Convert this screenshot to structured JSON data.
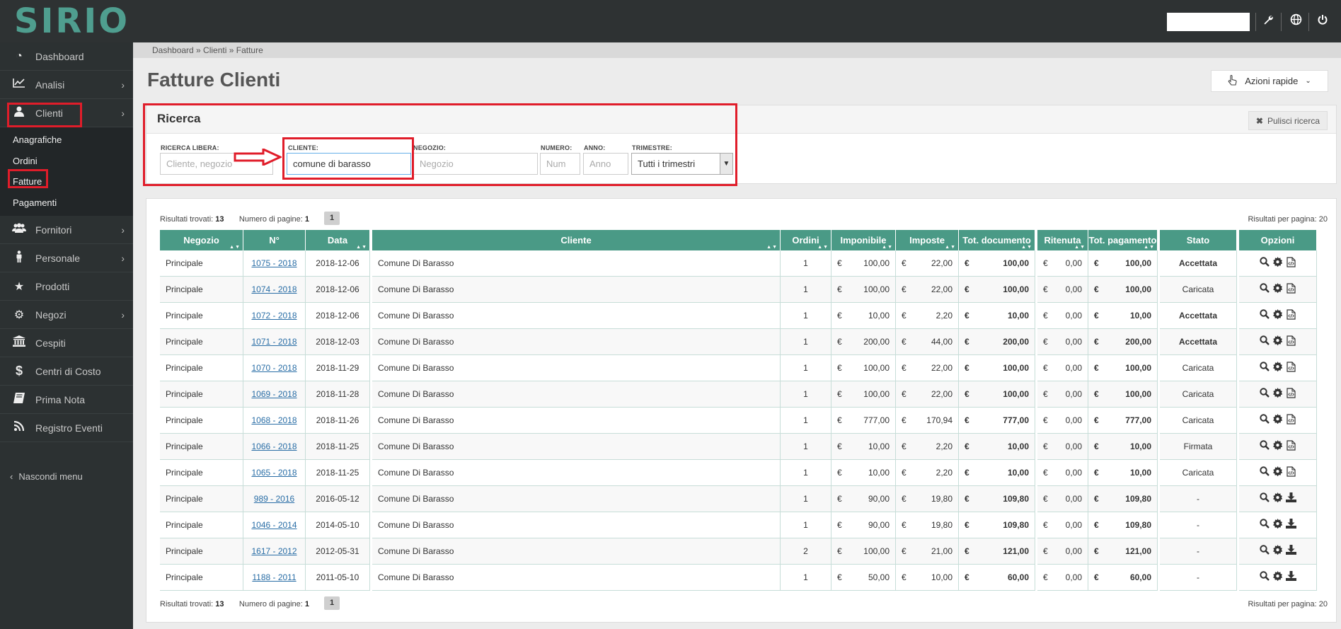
{
  "app": {
    "logo_text": "SIRIO"
  },
  "topbar": {
    "icons": [
      "wrench-icon",
      "globe-icon",
      "power-icon"
    ]
  },
  "sidebar": {
    "items": [
      {
        "label": "Dashboard",
        "icon": "dashboard-icon"
      },
      {
        "label": "Analisi",
        "icon": "chart-line-icon"
      },
      {
        "label": "Clienti",
        "icon": "user-icon"
      },
      {
        "label": "Fornitori",
        "icon": "users-icon"
      },
      {
        "label": "Personale",
        "icon": "person-icon"
      },
      {
        "label": "Prodotti",
        "icon": "star-icon"
      },
      {
        "label": "Negozi",
        "icon": "gear-icon"
      },
      {
        "label": "Cespiti",
        "icon": "bank-icon"
      },
      {
        "label": "Centri di Costo",
        "icon": "dollar-icon"
      },
      {
        "label": "Prima Nota",
        "icon": "book-icon"
      },
      {
        "label": "Registro Eventi",
        "icon": "rss-icon"
      }
    ],
    "clienti_sub": [
      "Anagrafiche",
      "Ordini",
      "Fatture",
      "Pagamenti"
    ],
    "hide_menu": "Nascondi menu"
  },
  "breadcrumb": "Dashboard » Clienti » Fatture",
  "page_title": "Fatture Clienti",
  "quick_actions": "Azioni rapide",
  "search": {
    "title": "Ricerca",
    "clear_label": "Pulisci ricerca",
    "labels": {
      "libera": "RICERCA LIBERA:",
      "cliente": "CLIENTE:",
      "negozio": "NEGOZIO:",
      "numero": "NUMERO:",
      "anno": "ANNO:",
      "trimestre": "TRIMESTRE:"
    },
    "placeholders": {
      "libera": "Cliente, negozio",
      "negozio": "Negozio",
      "numero": "Num",
      "anno": "Anno"
    },
    "cliente_value": "comune di barasso",
    "trimestre_value": "Tutti i trimestri"
  },
  "results": {
    "found_label": "Risultati trovati:",
    "found": "13",
    "pages_label": "Numero di pagine:",
    "pages": "1",
    "current_page": "1",
    "per_page": "Risultati per pagina: 20"
  },
  "columns": [
    "Negozio",
    "N°",
    "Data",
    "Cliente",
    "Ordini",
    "Imponibile",
    "Imposte",
    "Tot. documento",
    "Ritenuta",
    "Tot. pagamento",
    "Stato",
    "Opzioni"
  ],
  "currency": "€",
  "rows": [
    {
      "negozio": "Principale",
      "numero": "1075 - 2018",
      "data": "2018-12-06",
      "cliente": "Comune Di Barasso",
      "ordini": "1",
      "imponibile": "100,00",
      "imposte": "22,00",
      "tot_doc": "100,00",
      "ritenuta": "0,00",
      "tot_pag": "100,00",
      "stato": "Accettata",
      "stato_bold": true,
      "xml": true
    },
    {
      "negozio": "Principale",
      "numero": "1074 - 2018",
      "data": "2018-12-06",
      "cliente": "Comune Di Barasso",
      "ordini": "1",
      "imponibile": "100,00",
      "imposte": "22,00",
      "tot_doc": "100,00",
      "ritenuta": "0,00",
      "tot_pag": "100,00",
      "stato": "Caricata",
      "stato_bold": false,
      "xml": true
    },
    {
      "negozio": "Principale",
      "numero": "1072 - 2018",
      "data": "2018-12-06",
      "cliente": "Comune Di Barasso",
      "ordini": "1",
      "imponibile": "10,00",
      "imposte": "2,20",
      "tot_doc": "10,00",
      "ritenuta": "0,00",
      "tot_pag": "10,00",
      "stato": "Accettata",
      "stato_bold": true,
      "xml": true
    },
    {
      "negozio": "Principale",
      "numero": "1071 - 2018",
      "data": "2018-12-03",
      "cliente": "Comune Di Barasso",
      "ordini": "1",
      "imponibile": "200,00",
      "imposte": "44,00",
      "tot_doc": "200,00",
      "ritenuta": "0,00",
      "tot_pag": "200,00",
      "stato": "Accettata",
      "stato_bold": true,
      "xml": true
    },
    {
      "negozio": "Principale",
      "numero": "1070 - 2018",
      "data": "2018-11-29",
      "cliente": "Comune Di Barasso",
      "ordini": "1",
      "imponibile": "100,00",
      "imposte": "22,00",
      "tot_doc": "100,00",
      "ritenuta": "0,00",
      "tot_pag": "100,00",
      "stato": "Caricata",
      "stato_bold": false,
      "xml": true
    },
    {
      "negozio": "Principale",
      "numero": "1069 - 2018",
      "data": "2018-11-28",
      "cliente": "Comune Di Barasso",
      "ordini": "1",
      "imponibile": "100,00",
      "imposte": "22,00",
      "tot_doc": "100,00",
      "ritenuta": "0,00",
      "tot_pag": "100,00",
      "stato": "Caricata",
      "stato_bold": false,
      "xml": true
    },
    {
      "negozio": "Principale",
      "numero": "1068 - 2018",
      "data": "2018-11-26",
      "cliente": "Comune Di Barasso",
      "ordini": "1",
      "imponibile": "777,00",
      "imposte": "170,94",
      "tot_doc": "777,00",
      "ritenuta": "0,00",
      "tot_pag": "777,00",
      "stato": "Caricata",
      "stato_bold": false,
      "xml": true
    },
    {
      "negozio": "Principale",
      "numero": "1066 - 2018",
      "data": "2018-11-25",
      "cliente": "Comune Di Barasso",
      "ordini": "1",
      "imponibile": "10,00",
      "imposte": "2,20",
      "tot_doc": "10,00",
      "ritenuta": "0,00",
      "tot_pag": "10,00",
      "stato": "Firmata",
      "stato_bold": false,
      "xml": true
    },
    {
      "negozio": "Principale",
      "numero": "1065 - 2018",
      "data": "2018-11-25",
      "cliente": "Comune Di Barasso",
      "ordini": "1",
      "imponibile": "10,00",
      "imposte": "2,20",
      "tot_doc": "10,00",
      "ritenuta": "0,00",
      "tot_pag": "10,00",
      "stato": "Caricata",
      "stato_bold": false,
      "xml": true
    },
    {
      "negozio": "Principale",
      "numero": "989 - 2016",
      "data": "2016-05-12",
      "cliente": "Comune Di Barasso",
      "ordini": "1",
      "imponibile": "90,00",
      "imposte": "19,80",
      "tot_doc": "109,80",
      "ritenuta": "0,00",
      "tot_pag": "109,80",
      "stato": "-",
      "stato_bold": false,
      "xml": false
    },
    {
      "negozio": "Principale",
      "numero": "1046 - 2014",
      "data": "2014-05-10",
      "cliente": "Comune Di Barasso",
      "ordini": "1",
      "imponibile": "90,00",
      "imposte": "19,80",
      "tot_doc": "109,80",
      "ritenuta": "0,00",
      "tot_pag": "109,80",
      "stato": "-",
      "stato_bold": false,
      "xml": false
    },
    {
      "negozio": "Principale",
      "numero": "1617 - 2012",
      "data": "2012-05-31",
      "cliente": "Comune Di Barasso",
      "ordini": "2",
      "imponibile": "100,00",
      "imposte": "21,00",
      "tot_doc": "121,00",
      "ritenuta": "0,00",
      "tot_pag": "121,00",
      "stato": "-",
      "stato_bold": false,
      "xml": false
    },
    {
      "negozio": "Principale",
      "numero": "1188 - 2011",
      "data": "2011-05-10",
      "cliente": "Comune Di Barasso",
      "ordini": "1",
      "imponibile": "50,00",
      "imposte": "10,00",
      "tot_doc": "60,00",
      "ritenuta": "0,00",
      "tot_pag": "60,00",
      "stato": "-",
      "stato_bold": false,
      "xml": false
    }
  ]
}
